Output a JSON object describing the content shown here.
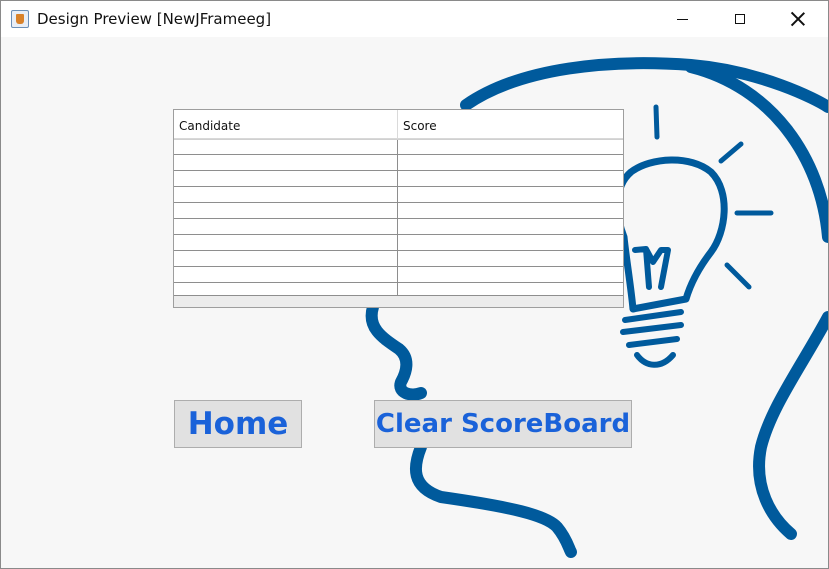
{
  "window": {
    "title": "Design Preview [NewJFrameeg]",
    "icon": "java-app-icon",
    "controls": [
      "minimize-icon",
      "maximize-icon",
      "close-icon"
    ]
  },
  "scoreboard": {
    "columns": [
      "Candidate",
      "Score"
    ],
    "rows": [
      [
        "",
        ""
      ],
      [
        "",
        ""
      ],
      [
        "",
        ""
      ],
      [
        "",
        ""
      ],
      [
        "",
        ""
      ],
      [
        "",
        ""
      ],
      [
        "",
        ""
      ],
      [
        "",
        ""
      ],
      [
        "",
        ""
      ],
      [
        "",
        ""
      ]
    ]
  },
  "buttons": {
    "home": "Home",
    "clear": "Clear ScoreBoard"
  },
  "background": {
    "illustration": "head-with-lightbulb-icon",
    "line_color": "#005a9c"
  },
  "colors": {
    "button_text": "#1a62d9",
    "button_bg": "#e1e1e1",
    "window_bg": "#f7f7f7"
  }
}
